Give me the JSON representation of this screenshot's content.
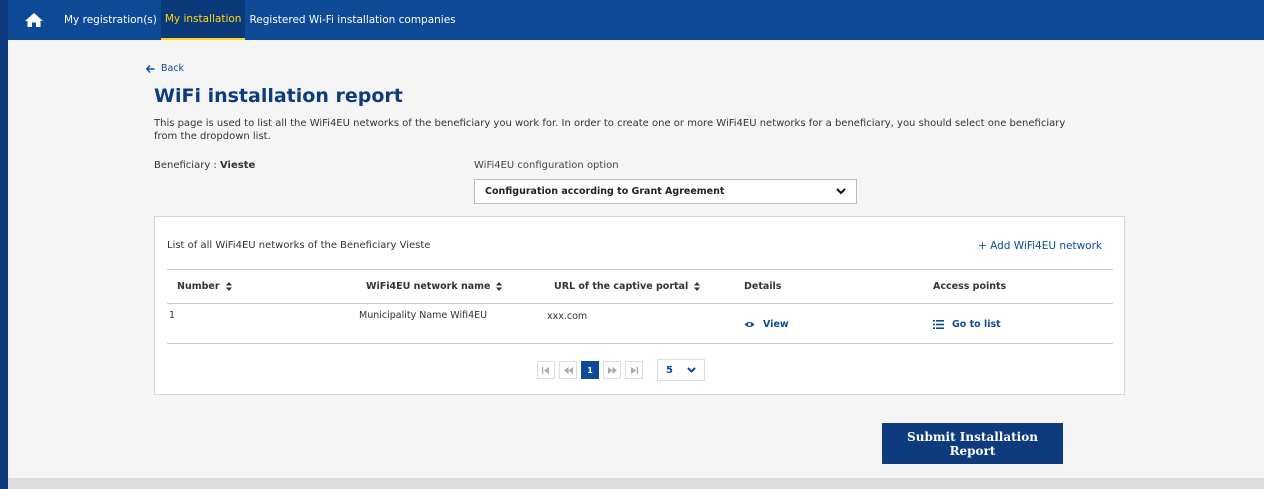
{
  "nav": {
    "items": [
      {
        "label": "My registration(s)"
      },
      {
        "label": "My installation"
      },
      {
        "label": "Registered Wi-Fi installation companies"
      }
    ],
    "active_index": 1
  },
  "back": {
    "label": "Back"
  },
  "page": {
    "title": "WiFi installation report",
    "intro_line1": "This page is used to list all the WiFi4EU networks of the beneficiary you work for. In order to create one or more WiFi4EU networks for a beneficiary, you should select one beneficiary",
    "intro_line2": "from the dropdown list."
  },
  "beneficiary": {
    "label": "Beneficiary :",
    "value": "Vieste"
  },
  "config": {
    "label": "WiFi4EU configuration option",
    "selected": "Configuration according to Grant Agreement"
  },
  "panel": {
    "caption": "List of all WiFi4EU networks of the Beneficiary Vieste",
    "add_label": "+ Add WiFi4EU network"
  },
  "table": {
    "headers": [
      "Number",
      "WiFi4EU network name",
      "URL of the captive portal",
      "Details",
      "Access points"
    ],
    "rows": [
      {
        "number": "1",
        "name": "Municipality Name Wifi4EU",
        "url": "xxx.com",
        "details": "View",
        "access": "Go to list"
      }
    ]
  },
  "pager": {
    "current_page": "1",
    "page_size": "5"
  },
  "submit": {
    "line1": "Submit Installation",
    "line2": "Report"
  },
  "colors": {
    "primary": "#0e4a96",
    "active_nav_text": "#ffd617"
  }
}
